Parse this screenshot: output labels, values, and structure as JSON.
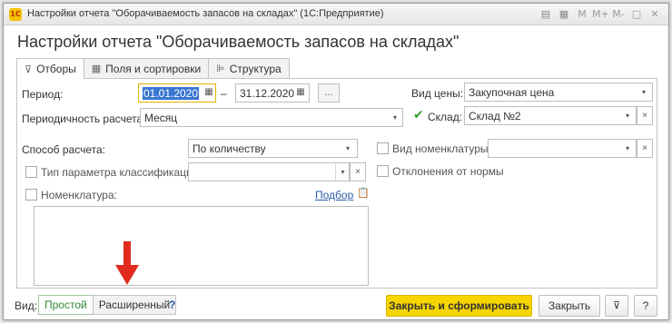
{
  "window": {
    "title": "Настройки отчета \"Оборачиваемость запасов на складах\"  (1С:Предприятие)",
    "app_icon_text": "1С",
    "icons": [
      "doc-icon",
      "calendar-icon",
      "memory-M",
      "memory-M-plus",
      "memory-M-minus",
      "minimize-icon",
      "close-icon"
    ],
    "icon_glyphs": {
      "m": "M",
      "mplus": "M+",
      "mminus": "M-",
      "restore": "□",
      "close": "✕"
    }
  },
  "form": {
    "title": "Настройки отчета \"Оборачиваемость запасов на складах\""
  },
  "tabs": [
    {
      "label": "Отборы",
      "icon": "filter-icon",
      "active": true
    },
    {
      "label": "Поля и сортировки",
      "icon": "table-icon",
      "active": false
    },
    {
      "label": "Структура",
      "icon": "tree-icon",
      "active": false
    }
  ],
  "filters": {
    "period_label": "Период:",
    "date_from": "01.01.2020",
    "date_dash": "–",
    "date_to": "31.12.2020",
    "period_more": "...",
    "periodicity_label": "Периодичность расчета:",
    "periodicity_value": "Месяц",
    "price_type_label": "Вид цены:",
    "price_type_value": "Закупочная цена",
    "warehouse_label": "Склад:",
    "warehouse_value": "Склад №2",
    "warehouse_checked": true,
    "calc_method_label": "Способ расчета:",
    "calc_method_value": "По количеству",
    "item_type_label": "Вид номенклатуры:",
    "item_type_value": "",
    "item_type_checked": false,
    "class_param_label": "Тип параметра классификации:",
    "class_param_value": "",
    "class_param_checked": false,
    "deviation_label": "Отклонения от нормы",
    "deviation_checked": false,
    "nomenclature_label": "Номенклатура:",
    "nomenclature_checked": false,
    "pick_link": "Подбор"
  },
  "glyphs": {
    "dropdown": "▾",
    "clear": "×",
    "calendar": "▦",
    "pick": "📋"
  },
  "bottom": {
    "view_label": "Вид:",
    "view_simple": "Простой",
    "view_extended": "Расширенный",
    "help": "?",
    "generate_button": "Закрыть и сформировать",
    "close_button": "Закрыть",
    "settings_icon": "filter-settings-icon",
    "help_button": "?"
  },
  "colors": {
    "primary_button": "#f6d500",
    "active_view": "#2e8b32",
    "link": "#2a5ca8",
    "arrow": "#e02b1e"
  }
}
